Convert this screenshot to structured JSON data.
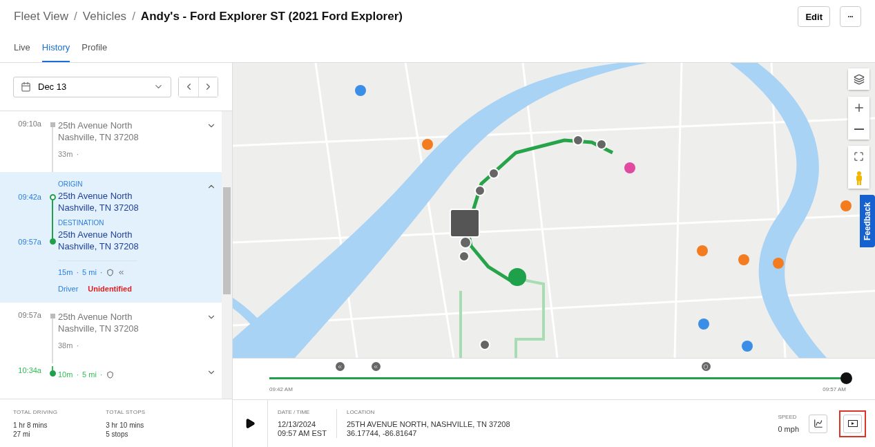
{
  "breadcrumb": [
    "Fleet View",
    "Vehicles",
    "Andy's - Ford Explorer ST (2021 Ford Explorer)"
  ],
  "breadcrumb_separator": "/",
  "meta_separator": "·",
  "header_buttons": [
    {
      "kind": "text",
      "label": "Edit"
    },
    {
      "kind": "more",
      "label": "···"
    }
  ],
  "tabs": [
    {
      "label": "Live",
      "selected": false
    },
    {
      "label": "History",
      "selected": true
    },
    {
      "label": "Profile",
      "selected": false
    }
  ],
  "date_picker": {
    "value": "Dec 13"
  },
  "entries": [
    {
      "kind": "stop",
      "time": "09:10a",
      "address": [
        "25th Avenue North",
        "Nashville, TN 37208"
      ],
      "duration": "33m",
      "expanded": false
    },
    {
      "kind": "trip",
      "selected": true,
      "expanded": true,
      "origin_label": "ORIGIN",
      "origin_time": "09:42a",
      "origin": [
        "25th Avenue North",
        "Nashville, TN 37208"
      ],
      "destination_label": "DESTINATION",
      "destination_time": "09:57a",
      "destination": [
        "25th Avenue North",
        "Nashville, TN 37208"
      ],
      "duration": "15m",
      "distance": "5 mi",
      "driver_label": "Driver",
      "driver": "Unidentified"
    },
    {
      "kind": "stop",
      "time": "09:57a",
      "address": [
        "25th Avenue North",
        "Nashville, TN 37208"
      ],
      "duration": "38m",
      "expanded": false
    },
    {
      "kind": "trip",
      "selected": false,
      "expanded": false,
      "origin_time": "10:34a",
      "duration": "10m",
      "distance": "5 mi"
    }
  ],
  "totals": [
    {
      "label": "TOTAL DRIVING",
      "lines": [
        "1 hr 8 mins",
        "27 mi"
      ]
    },
    {
      "label": "TOTAL STOPS",
      "lines": [
        "3 hr 10 mins",
        "5 stops"
      ]
    }
  ],
  "feedback": {
    "label": "Feedback"
  },
  "timeline": {
    "start": "09:42 AM",
    "end": "09:57 AM",
    "level": 1,
    "events": [
      {
        "kind": "rewind"
      },
      {
        "kind": "rewind"
      },
      {
        "kind": "shield"
      }
    ]
  },
  "details": [
    {
      "label": "DATE / TIME",
      "lines": [
        "12/13/2024",
        "09:57 AM EST"
      ]
    },
    {
      "label": "LOCATION",
      "lines": [
        "25TH AVENUE NORTH, NASHVILLE, TN 37208",
        "36.17744, -86.81647"
      ]
    }
  ],
  "speed": {
    "label": "SPEED",
    "value": "0 mph"
  },
  "video_button": {
    "highlighted": true
  }
}
